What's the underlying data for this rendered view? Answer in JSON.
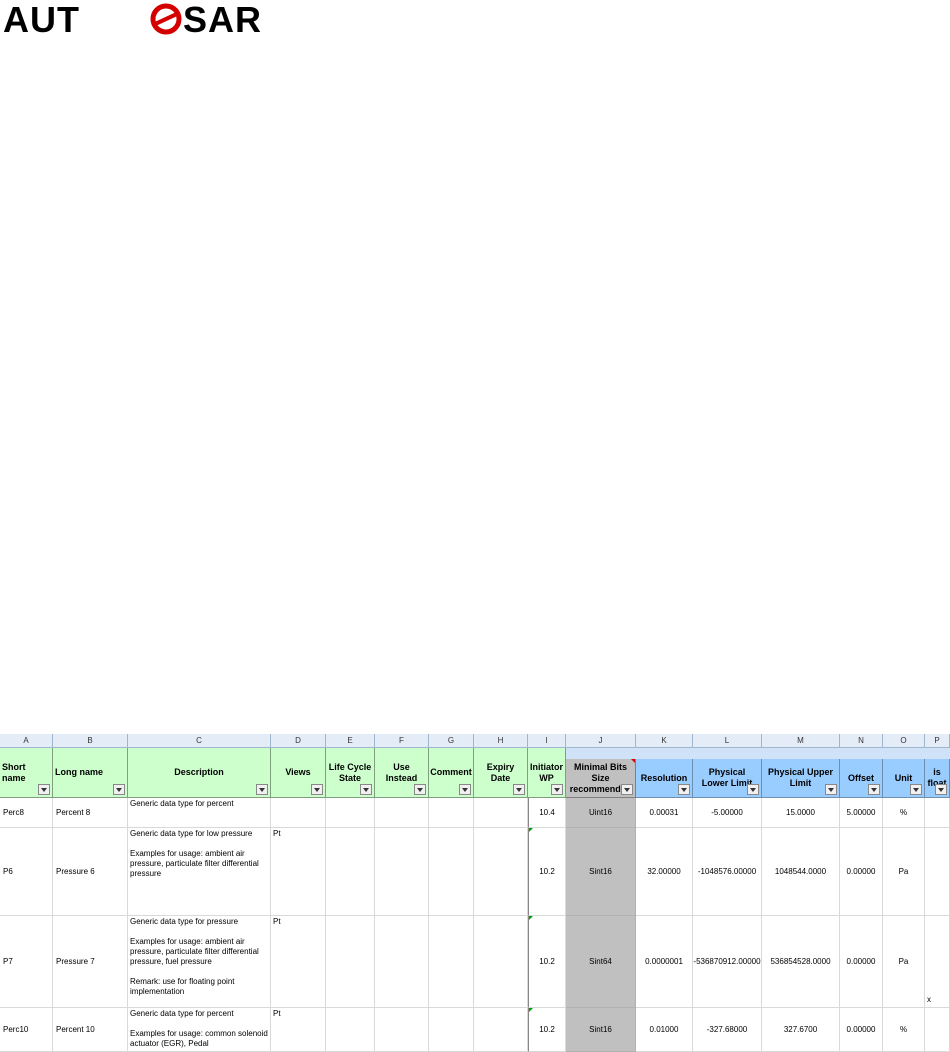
{
  "logo": {
    "text": "AUTOSAR",
    "color": "#d40000",
    "ring_color": "#d40000",
    "letter_color": "#000000"
  },
  "sheet": {
    "column_letters": [
      "A",
      "B",
      "C",
      "D",
      "E",
      "F",
      "G",
      "H",
      "I",
      "J",
      "K",
      "L",
      "M",
      "N",
      "O",
      "P"
    ],
    "headers": {
      "short_name": "Short name",
      "long_name": "Long name",
      "description": "Description",
      "views": "Views",
      "life_cycle_state": "Life Cycle State",
      "use_instead": "Use Instead",
      "comment": "Comment",
      "expiry_date": "Expiry Date",
      "initiator_wp": "Initiator WP",
      "min_bits": "Minimal Bits Size recommended",
      "resolution": "Resolution",
      "phys_lower": "Physical Lower Limit",
      "phys_upper": "Physical Upper Limit",
      "offset": "Offset",
      "unit": "Unit",
      "is_float": "is float"
    },
    "rows": [
      {
        "short_name": "Perc8",
        "long_name": "Percent 8",
        "description": "Generic data type for percent",
        "views": "",
        "initiator_wp": "10.4",
        "min_bits": "Uint16",
        "resolution": "0.00031",
        "phys_lower": "-5.00000",
        "phys_upper": "15.0000",
        "offset": "5.00000",
        "unit": "%",
        "is_float": ""
      },
      {
        "short_name": "P6",
        "long_name": "Pressure 6",
        "description": "Generic data type for low pressure\n\nExamples for usage: ambient air pressure, particulate filter differential pressure",
        "views": "Pt",
        "initiator_wp": "10.2",
        "min_bits": "Sint16",
        "resolution": "32.00000",
        "phys_lower": "-1048576.00000",
        "phys_upper": "1048544.0000",
        "offset": "0.00000",
        "unit": "Pa",
        "is_float": ""
      },
      {
        "short_name": "P7",
        "long_name": "Pressure 7",
        "description": "Generic data type for pressure\n\nExamples for usage: ambient air pressure, particulate filter differential pressure, fuel pressure\n\nRemark: use for floating point implementation",
        "views": "Pt",
        "initiator_wp": "10.2",
        "min_bits": "Sint64",
        "resolution": "0.0000001",
        "phys_lower": "-536870912.00000",
        "phys_upper": "536854528.0000",
        "offset": "0.00000",
        "unit": "Pa",
        "is_float": "x"
      },
      {
        "short_name": "Perc10",
        "long_name": "Percent 10",
        "description": "Generic data type for percent\n\nExamples for usage: common solenoid actuator (EGR), Pedal",
        "views": "Pt",
        "initiator_wp": "10.2",
        "min_bits": "Sint16",
        "resolution": "0.01000",
        "phys_lower": "-327.68000",
        "phys_upper": "327.6700",
        "offset": "0.00000",
        "unit": "%",
        "is_float": ""
      }
    ]
  }
}
